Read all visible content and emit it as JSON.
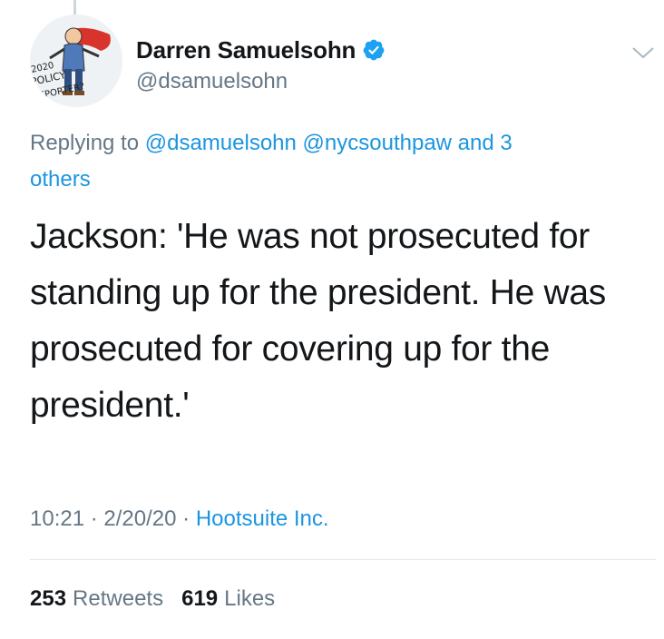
{
  "author": {
    "display_name": "Darren Samuelsohn",
    "handle": "@dsamuelsohn",
    "verified": true,
    "avatar_text": [
      "2020",
      "POLICY",
      "REPORTER?"
    ]
  },
  "reply": {
    "prefix": "Replying to",
    "mentions": [
      "@dsamuelsohn",
      "@nycsouthpaw"
    ],
    "suffix_line1": "and 3",
    "suffix_line2": "others"
  },
  "tweet": {
    "lines": [
      "Jackson: 'He was not prosecuted for",
      "standing up for the president. He was",
      "prosecuted for covering up for the",
      "president.'"
    ]
  },
  "meta": {
    "time": "10:21",
    "date": "2/20/20",
    "source": "Hootsuite Inc.",
    "separator": "·"
  },
  "stats": {
    "retweets_count": "253",
    "retweets_label": "Retweets",
    "likes_count": "619",
    "likes_label": "Likes"
  },
  "colors": {
    "link": "#1b95e0",
    "secondary": "#657786",
    "primary_text": "#14171a",
    "verified": "#1da1f2"
  },
  "icons": {
    "verified": "verified-badge-icon",
    "menu": "chevron-down-icon"
  }
}
